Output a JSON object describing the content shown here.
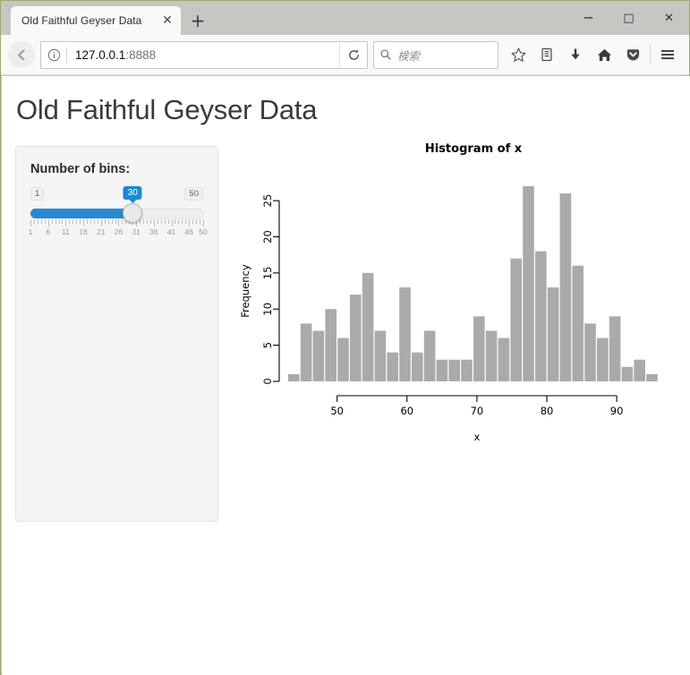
{
  "browser": {
    "tab": {
      "title": "Old Faithful Geyser Data",
      "close_label": "✕"
    },
    "new_tab_label": "+",
    "window_controls": {
      "minimize": "─",
      "maximize": "□",
      "close": "✕"
    },
    "url": {
      "host": "127.0.0.1",
      "port": ":8888"
    },
    "search": {
      "placeholder": "検索"
    },
    "toolbar_icons": [
      "back-icon",
      "identity-icon",
      "reload-icon",
      "search-icon",
      "bookmark-star-icon",
      "library-icon",
      "downloads-icon",
      "home-icon",
      "pocket-icon",
      "hamburger-menu-icon"
    ]
  },
  "page": {
    "title": "Old Faithful Geyser Data"
  },
  "sidebar": {
    "slider_label": "Number of bins:",
    "slider": {
      "min": 1,
      "max": 50,
      "value": 30,
      "min_label": "1",
      "max_label": "50",
      "value_label": "30",
      "tick_labels": [
        "1",
        "6",
        "11",
        "16",
        "21",
        "26",
        "31",
        "36",
        "41",
        "46",
        "50"
      ],
      "tick_values": [
        1,
        6,
        11,
        16,
        21,
        26,
        31,
        36,
        41,
        46,
        50
      ]
    }
  },
  "chart_data": {
    "type": "bar",
    "title": "Histogram of x",
    "xlabel": "x",
    "ylabel": "Frequency",
    "xlim": [
      43,
      96
    ],
    "ylim": [
      0,
      27
    ],
    "xticks": [
      50,
      60,
      70,
      80,
      90
    ],
    "yticks": [
      0,
      5,
      10,
      15,
      20,
      25
    ],
    "grid": false,
    "legend": "none",
    "bar_color": "#aaaaaa",
    "bin_count": 30,
    "bin_width": 1.7666,
    "bin_starts": [
      43.0,
      44.77,
      46.53,
      48.3,
      50.07,
      51.83,
      53.6,
      55.37,
      57.13,
      58.9,
      60.67,
      62.43,
      64.2,
      65.97,
      67.73,
      69.5,
      71.27,
      73.03,
      74.8,
      76.57,
      78.33,
      80.1,
      81.87,
      83.63,
      85.4,
      87.17,
      88.93,
      90.7,
      92.47,
      94.23
    ],
    "categories": [
      "43.0",
      "44.8",
      "46.5",
      "48.3",
      "50.1",
      "51.8",
      "53.6",
      "55.4",
      "57.1",
      "58.9",
      "60.7",
      "62.4",
      "64.2",
      "66.0",
      "67.7",
      "69.5",
      "71.3",
      "73.0",
      "74.8",
      "76.6",
      "78.3",
      "80.1",
      "81.9",
      "83.6",
      "85.4",
      "87.2",
      "88.9",
      "90.7",
      "92.5",
      "94.2"
    ],
    "values": [
      1,
      8,
      7,
      10,
      6,
      12,
      15,
      7,
      4,
      13,
      4,
      7,
      3,
      3,
      3,
      9,
      7,
      6,
      17,
      27,
      18,
      13,
      26,
      16,
      8,
      6,
      9,
      2,
      3,
      1
    ]
  }
}
